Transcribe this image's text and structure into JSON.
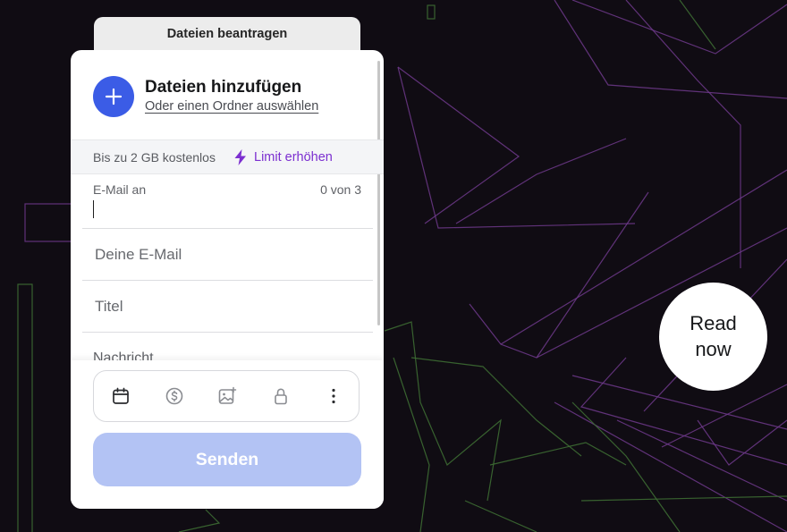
{
  "tab": {
    "label": "Dateien beantragen"
  },
  "upload": {
    "title": "Dateien hinzufügen",
    "folder_link": "Oder einen Ordner auswählen",
    "add_icon": "plus-icon"
  },
  "limit": {
    "text": "Bis zu 2 GB kostenlos",
    "link": "Limit erhöhen",
    "icon": "lightning-bolt-icon"
  },
  "form": {
    "email_to_label": "E-Mail an",
    "email_to_count": "0 von 3",
    "your_email_placeholder": "Deine E-Mail",
    "title_placeholder": "Titel",
    "message_placeholder": "Nachricht"
  },
  "toolbar": {
    "icons": [
      "calendar-icon",
      "dollar-icon",
      "image-icon",
      "lock-icon",
      "more-vertical-icon"
    ]
  },
  "send": {
    "label": "Senden"
  },
  "promo": {
    "line1": "Read",
    "line2": "now"
  },
  "colors": {
    "accent": "#3b5ce6",
    "link_purple": "#7c2fd0",
    "send_disabled": "#b3c3f4",
    "background": "#100c13",
    "bg_lines_purple": "#6e3a8c",
    "bg_lines_green": "#3d6b33"
  }
}
